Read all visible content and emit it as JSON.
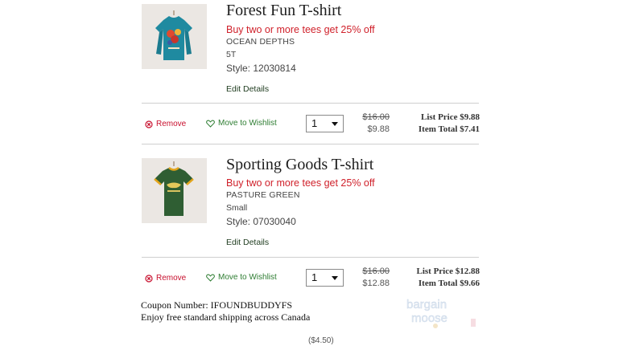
{
  "items": [
    {
      "title": "Forest Fun T-shirt",
      "promo": "Buy two or more tees get 25% off",
      "color": "OCEAN DEPTHS",
      "size": "5T",
      "style": "Style: 12030814",
      "edit_label": "Edit Details",
      "remove_label": "Remove",
      "wishlist_label": "Move to Wishlist",
      "quantity": "1",
      "old_price": "$16.00",
      "new_price": "$9.88",
      "list_price": "List Price $9.88",
      "item_total": "Item Total $7.41",
      "shirt_color": "#1f8aa0"
    },
    {
      "title": "Sporting Goods T-shirt",
      "promo": "Buy two or more tees get 25% off",
      "color": "PASTURE GREEN",
      "size": "Small",
      "style": "Style: 07030040",
      "edit_label": "Edit Details",
      "remove_label": "Remove",
      "wishlist_label": "Move to Wishlist",
      "quantity": "1",
      "old_price": "$16.00",
      "new_price": "$12.88",
      "list_price": "List Price $12.88",
      "item_total": "Item Total $9.66",
      "shirt_color": "#2f5e33",
      "trim_color": "#e3a51c"
    }
  ],
  "coupon": {
    "number_line": "Coupon Number: IFOUNDBUDDYFS",
    "shipping_line": "Enjoy free standard shipping across Canada",
    "discount": "($4.50)"
  },
  "watermark": {
    "line1": "bargain",
    "line2": "moose"
  },
  "colors": {
    "promo_red": "#d0212b",
    "remove_red": "#c8102e",
    "wishlist_green": "#2e7d32",
    "rule_gray": "#cfcfcf"
  }
}
